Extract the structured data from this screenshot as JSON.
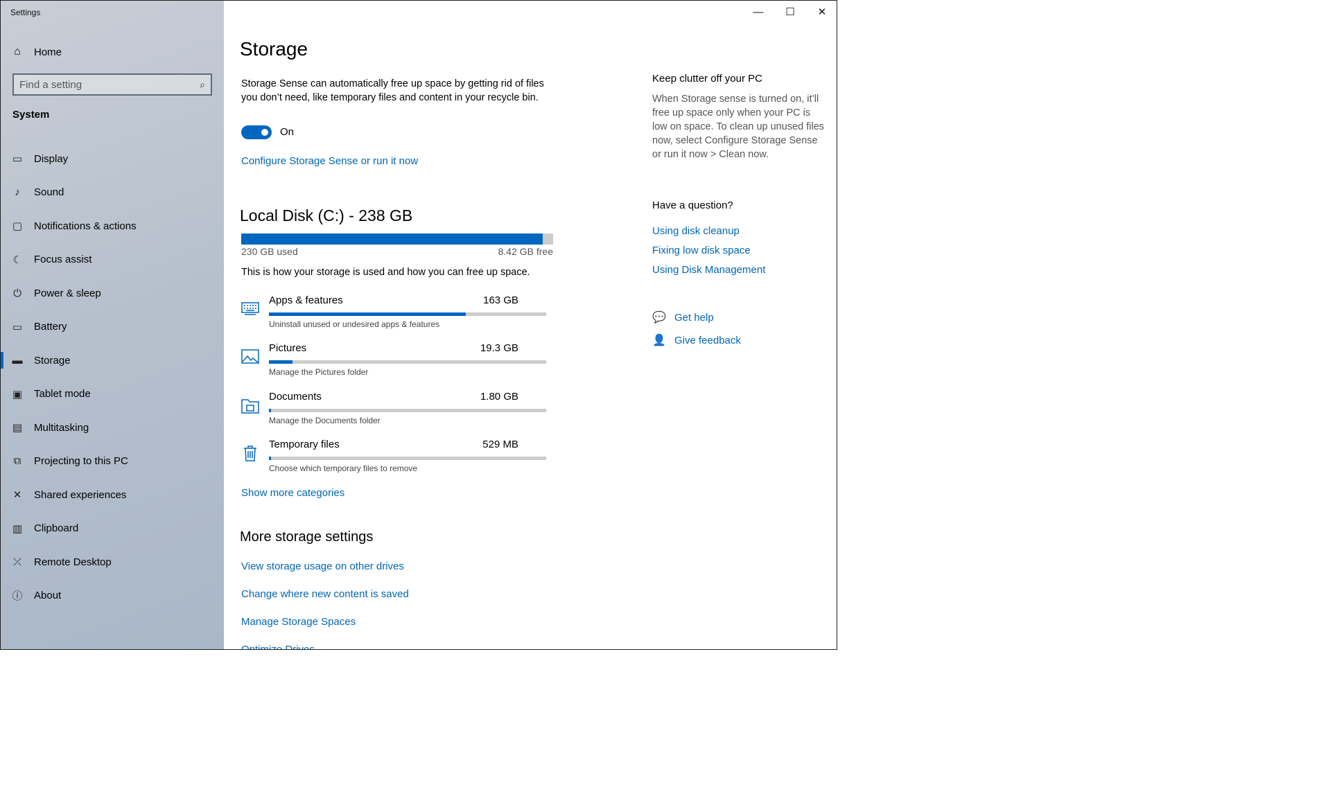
{
  "window": {
    "app_title": "Settings",
    "controls": {
      "minimize": "—",
      "maximize": "☐",
      "close": "✕"
    }
  },
  "sidebar": {
    "home_label": "Home",
    "search_placeholder": "Find a setting",
    "section_label": "System",
    "items": [
      {
        "label": "Display",
        "icon": "display-icon"
      },
      {
        "label": "Sound",
        "icon": "sound-icon"
      },
      {
        "label": "Notifications & actions",
        "icon": "notifications-icon"
      },
      {
        "label": "Focus assist",
        "icon": "moon-icon"
      },
      {
        "label": "Power & sleep",
        "icon": "power-icon"
      },
      {
        "label": "Battery",
        "icon": "battery-icon"
      },
      {
        "label": "Storage",
        "icon": "storage-icon",
        "active": true
      },
      {
        "label": "Tablet mode",
        "icon": "tablet-icon"
      },
      {
        "label": "Multitasking",
        "icon": "multitasking-icon"
      },
      {
        "label": "Projecting to this PC",
        "icon": "projecting-icon"
      },
      {
        "label": "Shared experiences",
        "icon": "shared-icon"
      },
      {
        "label": "Clipboard",
        "icon": "clipboard-icon"
      },
      {
        "label": "Remote Desktop",
        "icon": "remote-desktop-icon"
      },
      {
        "label": "About",
        "icon": "info-icon"
      }
    ]
  },
  "main": {
    "title": "Storage",
    "description": "Storage Sense can automatically free up space by getting rid of files you don’t need, like temporary files and content in your recycle bin.",
    "toggle_state": "On",
    "configure_link": "Configure Storage Sense or run it now",
    "disk": {
      "title": "Local Disk (C:) - 238 GB",
      "used": "230 GB used",
      "free": "8.42 GB free",
      "used_fraction": 0.966,
      "note": "This is how your storage is used and how you can free up space."
    },
    "categories": [
      {
        "name": "Apps & features",
        "size": "163 GB",
        "sub": "Uninstall unused or undesired apps & features",
        "fraction": 0.71,
        "icon": "apps-icon"
      },
      {
        "name": "Pictures",
        "size": "19.3 GB",
        "sub": "Manage the Pictures folder",
        "fraction": 0.085,
        "icon": "pictures-icon"
      },
      {
        "name": "Documents",
        "size": "1.80 GB",
        "sub": "Manage the Documents folder",
        "fraction": 0.008,
        "icon": "documents-icon"
      },
      {
        "name": "Temporary files",
        "size": "529 MB",
        "sub": "Choose which temporary files to remove",
        "fraction": 0.003,
        "icon": "trash-icon"
      }
    ],
    "show_more": "Show more categories",
    "more_settings_title": "More storage settings",
    "more_links": [
      "View storage usage on other drives",
      "Change where new content is saved",
      "Manage Storage Spaces",
      "Optimize Drives"
    ]
  },
  "aside": {
    "clutter_title": "Keep clutter off your PC",
    "clutter_text": "When Storage sense is turned on, it’ll free up space only when your PC is low on space. To clean up unused files now, select Configure Storage Sense or run it now > Clean now.",
    "question_title": "Have a question?",
    "links": [
      "Using disk cleanup",
      "Fixing low disk space",
      "Using Disk Management"
    ],
    "get_help": "Get help",
    "give_feedback": "Give feedback"
  },
  "colors": {
    "accent": "#0067c0",
    "link": "#0066b4",
    "bar_track": "#cccccc"
  }
}
